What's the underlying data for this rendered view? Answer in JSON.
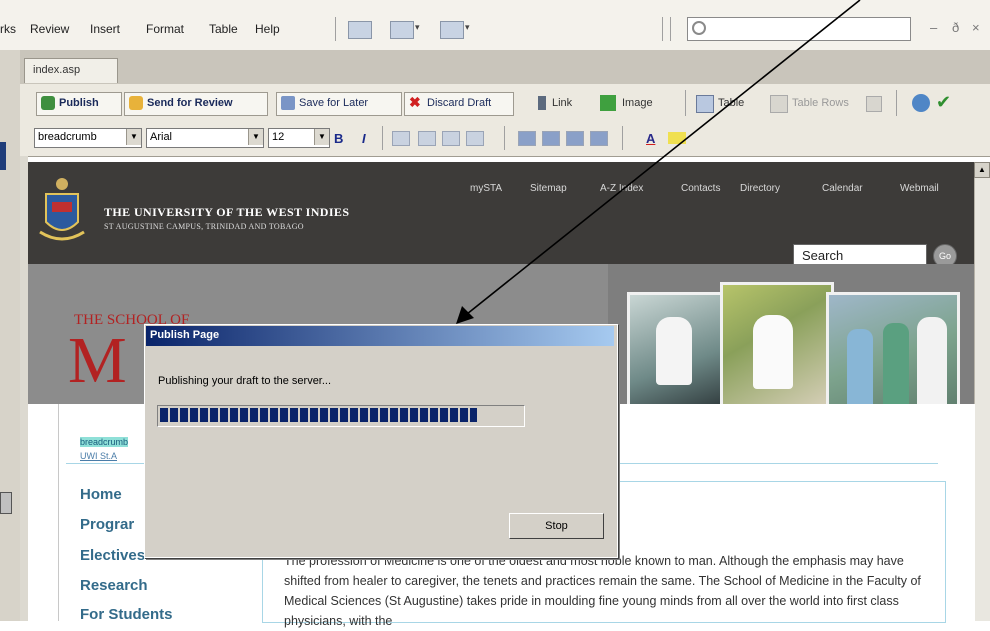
{
  "menubar": {
    "items": [
      "rks",
      "Review",
      "Insert",
      "Format",
      "Table",
      "Help"
    ],
    "search_placeholder": "",
    "window_controls": [
      "–",
      "ð",
      "×"
    ]
  },
  "tabs": [
    {
      "label": "index.asp"
    }
  ],
  "toolbar": {
    "publish": "Publish",
    "send_review": "Send for Review",
    "save_later": "Save for Later",
    "discard": "Discard Draft",
    "link": "Link",
    "image": "Image",
    "table": "Table",
    "table_rows": "Table Rows"
  },
  "format_bar": {
    "style": "breadcrumb",
    "font": "Arial",
    "size": "12",
    "bold": "B",
    "italic": "I",
    "text_color": "A"
  },
  "site": {
    "university_name": "THE UNIVERSITY OF THE WEST INDIES",
    "campus": "ST AUGUSTINE CAMPUS, TRINIDAD AND TOBAGO",
    "top_nav": [
      "mySTA",
      "Sitemap",
      "A-Z Index",
      "Contacts",
      "Directory",
      "Calendar",
      "Webmail"
    ],
    "search_label": "Search",
    "go_label": "Go",
    "school_of": "THE SCHOOL OF",
    "school_initial": "M",
    "breadcrumb": "breadcrumb",
    "breadcrumb_link": "UWI St.A",
    "sidenav": [
      "Home",
      "Prograr",
      "Electives",
      "Research",
      "For Students"
    ],
    "intro_text": "The profession of Medicine is one of the oldest and most noble known to man. Although the emphasis may have shifted from healer to caregiver, the tenets and practices remain the same. The School of Medicine in the Faculty of Medical Sciences (St Augustine) takes pride in moulding fine young minds from all over the world into first class physicians, with the"
  },
  "dialog": {
    "title": "Publish Page",
    "message": "Publishing your draft to the server...",
    "progress": 0.88,
    "stop_label": "Stop"
  }
}
